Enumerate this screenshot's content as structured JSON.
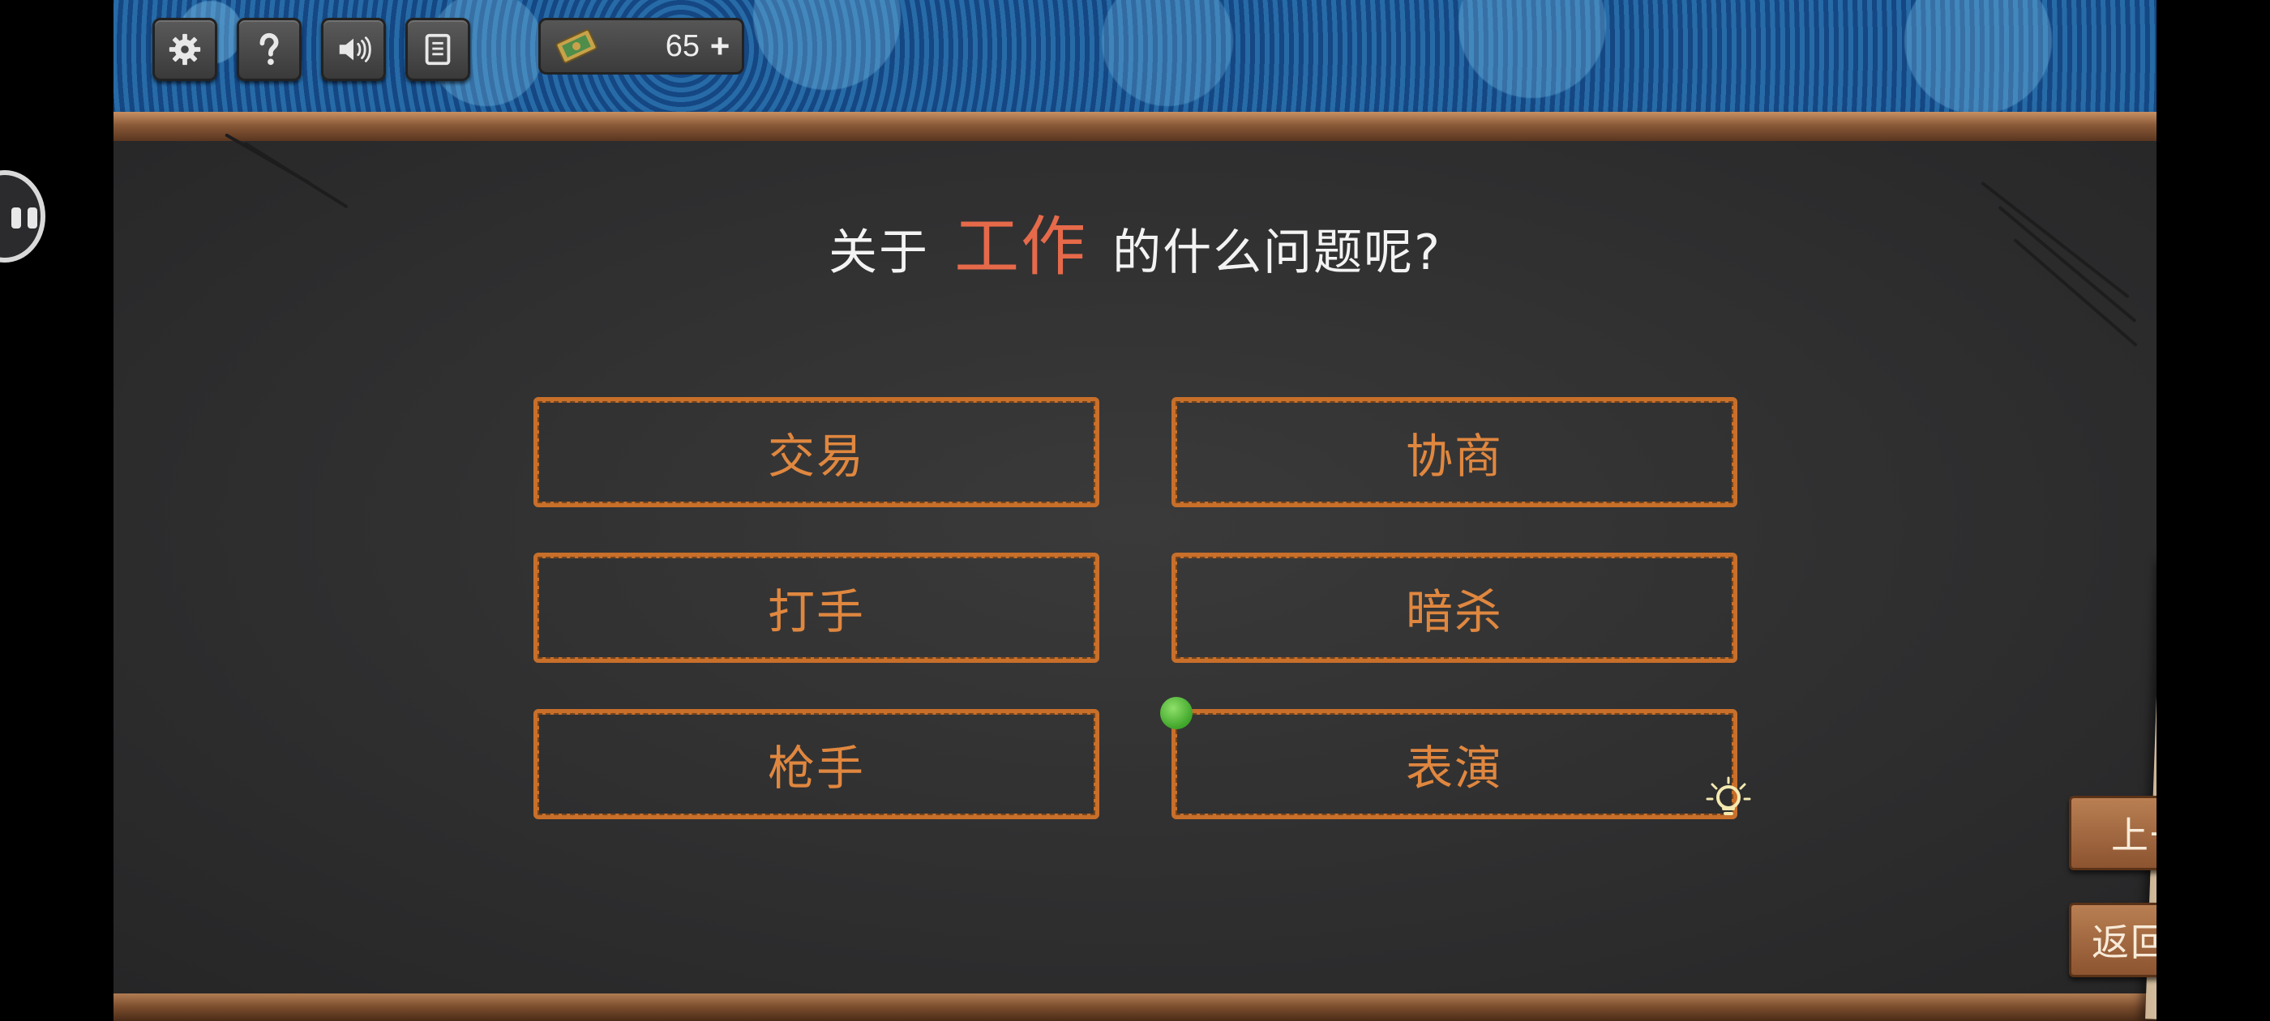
{
  "toolbar": {
    "buttons": [
      {
        "name": "settings",
        "icon": "gear-icon"
      },
      {
        "name": "help",
        "icon": "question-icon"
      },
      {
        "name": "sound",
        "icon": "speaker-icon"
      },
      {
        "name": "log",
        "icon": "notebook-icon"
      }
    ],
    "currency": {
      "icon": "ticket-icon",
      "value": "65",
      "add_label": "+"
    }
  },
  "question": {
    "prefix": "关于",
    "keyword": "工作",
    "suffix": "的什么问题呢?"
  },
  "choices": [
    {
      "label": "交易"
    },
    {
      "label": "协商"
    },
    {
      "label": "打手"
    },
    {
      "label": "暗杀"
    },
    {
      "label": "枪手"
    },
    {
      "label": "表演"
    }
  ],
  "side_buttons": {
    "prev_word": "上一词",
    "back_to_story": "返回故事"
  },
  "colors": {
    "keyword": "#e66a4a",
    "choice_border": "#c86f2a",
    "choice_text": "#e0873f",
    "board": "#2f2f30"
  }
}
